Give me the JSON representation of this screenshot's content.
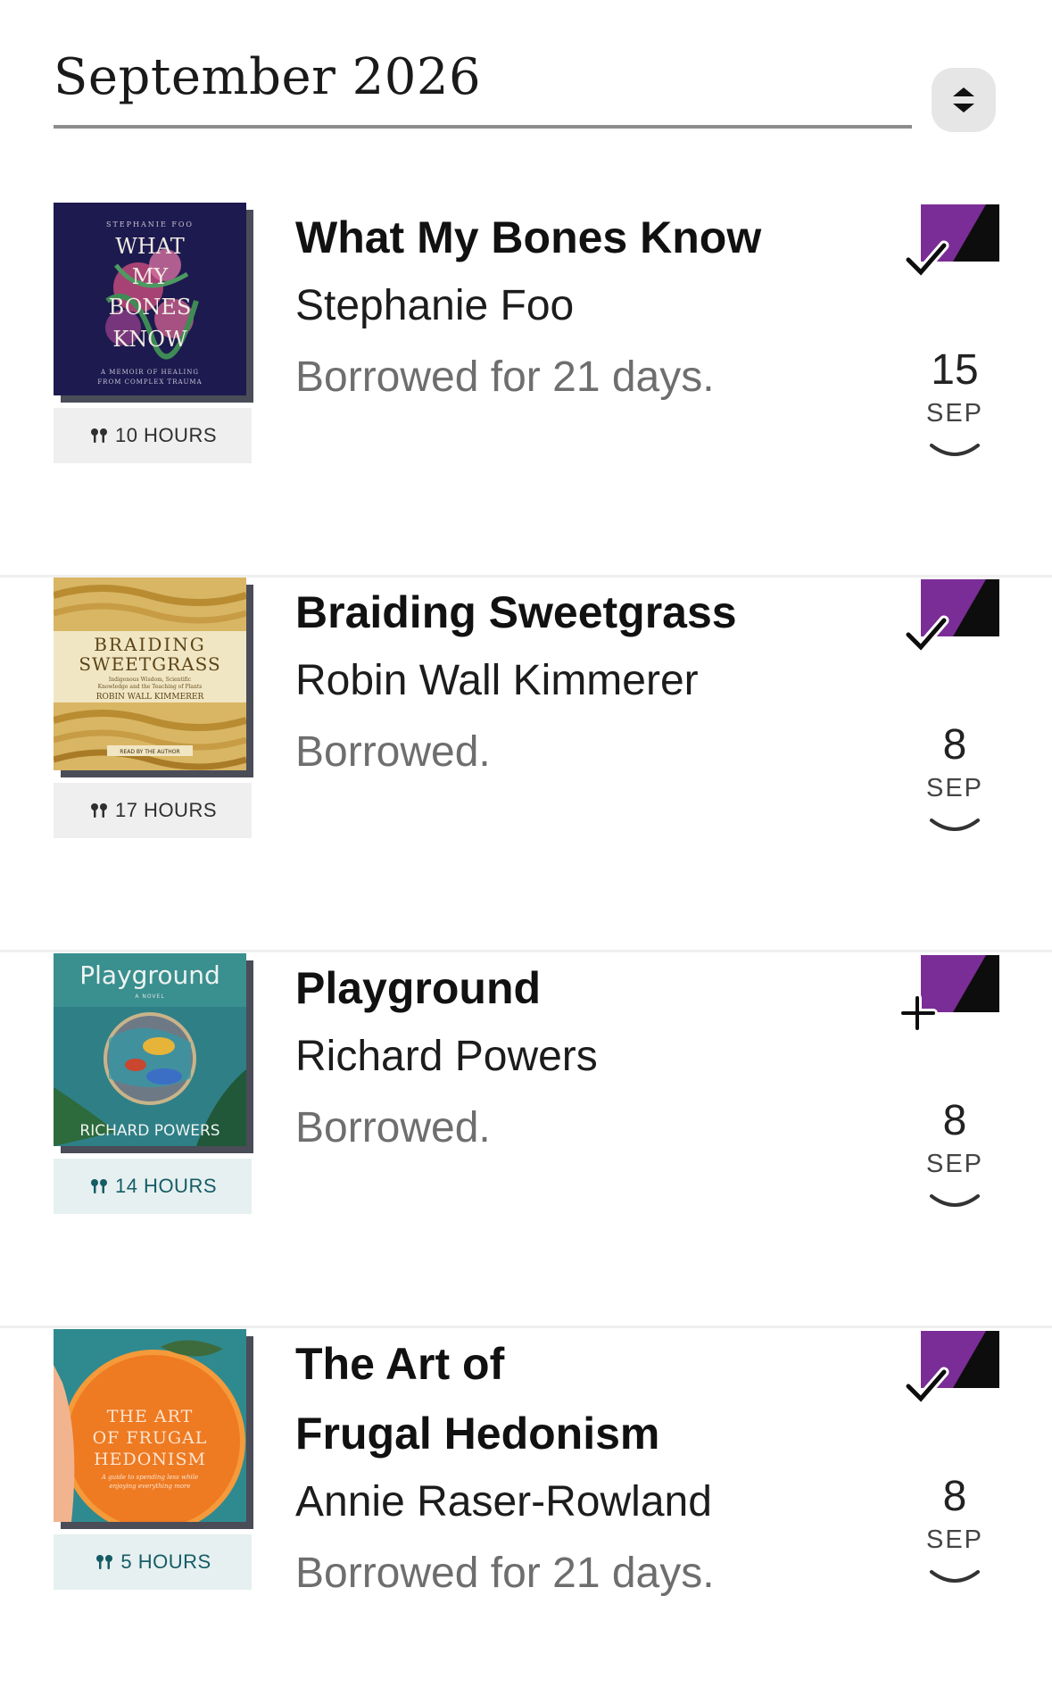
{
  "header": {
    "month_title": "September 2026"
  },
  "books": [
    {
      "title": "What My Bones Know",
      "author": "Stephanie Foo",
      "status": "Borrowed for 21 days.",
      "duration": "10 HOURS",
      "due_day": "15",
      "due_month": "SEP",
      "action_icon": "borrowed-check-icon",
      "cover": {
        "top_author": "STEPHANIE FOO",
        "words": [
          "WHAT",
          "MY",
          "BONES",
          "KNOW"
        ],
        "subtitle": "A MEMOIR OF HEALING",
        "subtitle2": "FROM COMPLEX TRAUMA"
      }
    },
    {
      "title": "Braiding Sweetgrass",
      "author": "Robin Wall Kimmerer",
      "status": "Borrowed.",
      "duration": "17 HOURS",
      "due_day": "8",
      "due_month": "SEP",
      "action_icon": "borrowed-check-icon",
      "cover": {
        "line1": "BRAIDING",
        "line2": "SWEETGRASS",
        "sub1": "Indigenous Wisdom, Scientific",
        "sub2": "Knowledge and the Teaching of Plants",
        "author": "ROBIN WALL KIMMERER",
        "foot": "READ BY THE AUTHOR"
      }
    },
    {
      "title": "Playground",
      "author": "Richard Powers",
      "status": "Borrowed.",
      "duration": "14 HOURS",
      "due_day": "8",
      "due_month": "SEP",
      "action_icon": "add-plus-icon",
      "cover": {
        "title": "Playground",
        "novel": "A NOVEL",
        "author": "RICHARD POWERS"
      }
    },
    {
      "title_line1": "The Art of",
      "title_line2": "Frugal Hedonism",
      "author": "Annie Raser-Rowland",
      "status": "Borrowed for 21 days.",
      "duration": "5 HOURS",
      "due_day": "8",
      "due_month": "SEP",
      "action_icon": "borrowed-check-icon",
      "cover": {
        "line1": "THE ART",
        "line2": "OF FRUGAL",
        "line3": "HEDONISM",
        "sub1": "A guide to spending less while",
        "sub2": "enjoying everything more"
      }
    }
  ],
  "colors": {
    "accent_purple": "#7b2d97",
    "icon_black": "#0d0d0d",
    "status_gray": "#6e6e6e",
    "badge_teal": "#155c66"
  }
}
